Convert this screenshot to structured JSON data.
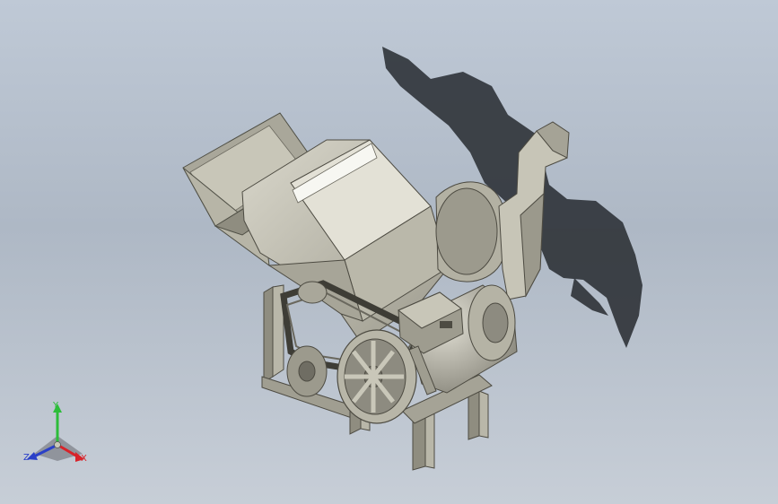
{
  "viewport": {
    "background_top": "#bfc9d6",
    "background_bottom": "#c7ced7",
    "model_color": "#c4c2b4",
    "shadow_color": "#2f3338"
  },
  "triad": {
    "y_label": "Y",
    "z_label": "Z",
    "x_label": "X",
    "y_color": "#2dbd3a",
    "z_color": "#2a40c8",
    "x_color": "#d8232a"
  }
}
